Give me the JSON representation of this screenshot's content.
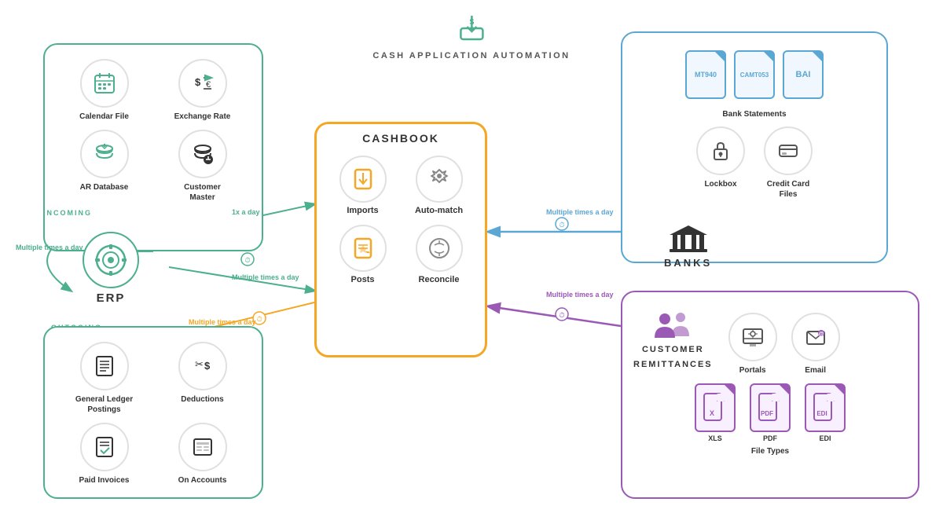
{
  "title": {
    "icon": "💲",
    "text": "CASH APPLICATION AUTOMATION"
  },
  "cashbook": {
    "title": "CASHBOOK",
    "items": [
      {
        "id": "imports",
        "label": "Imports",
        "icon": "⬇"
      },
      {
        "id": "auto-match",
        "label": "Auto-match",
        "icon": "⚙"
      },
      {
        "id": "posts",
        "label": "Posts",
        "icon": "✏"
      },
      {
        "id": "reconcile",
        "label": "Reconcile",
        "icon": "⚖"
      }
    ]
  },
  "incoming": {
    "label": "INCOMING",
    "items": [
      {
        "id": "calendar-file",
        "label": "Calendar\nFile",
        "icon": "📅"
      },
      {
        "id": "exchange-rate",
        "label": "Exchange\nRate",
        "icon": "💱"
      },
      {
        "id": "ar-database",
        "label": "AR\nDatabase",
        "icon": "🗄"
      },
      {
        "id": "customer-master",
        "label": "Customer\nMaster",
        "icon": "👤"
      }
    ]
  },
  "outgoing": {
    "label": "OUTGOING",
    "items": [
      {
        "id": "general-ledger",
        "label": "General Ledger\nPostings",
        "icon": "📋"
      },
      {
        "id": "deductions",
        "label": "Deductions",
        "icon": "✂"
      },
      {
        "id": "paid-invoices",
        "label": "Paid Invoices",
        "icon": "✔"
      },
      {
        "id": "on-accounts",
        "label": "On Accounts",
        "icon": "🖩"
      }
    ]
  },
  "erp": {
    "label": "ERP",
    "icon": "⚙"
  },
  "banks": {
    "label": "BANKS",
    "bank_statements_label": "Bank Statements",
    "files": [
      "MT940",
      "CAMT053",
      "BAI"
    ],
    "items": [
      {
        "id": "lockbox",
        "label": "Lockbox",
        "icon": "🔒"
      },
      {
        "id": "credit-card-files",
        "label": "Credit Card\nFiles",
        "icon": "💳"
      }
    ]
  },
  "customer_remittances": {
    "title_line1": "CUSTOMER",
    "title_line2": "REMITTANCES",
    "portals_label": "Portals",
    "email_label": "Email",
    "file_types_label": "File Types",
    "file_types": [
      "XLS",
      "PDF",
      "EDI"
    ],
    "top_items": [
      {
        "id": "portals",
        "label": "Portals",
        "icon": "🖥"
      },
      {
        "id": "email",
        "label": "Email",
        "icon": "✉"
      }
    ]
  },
  "annotations": {
    "erp_loop": "Multiple\ntimes a day",
    "green_1x": "1x a day",
    "green_multiple": "Multiple\ntimes a day",
    "orange_multiple": "Multiple\ntimes a day",
    "blue_multiple": "Multiple\ntimes a day",
    "purple_multiple": "Multiple\ntimes a day"
  }
}
